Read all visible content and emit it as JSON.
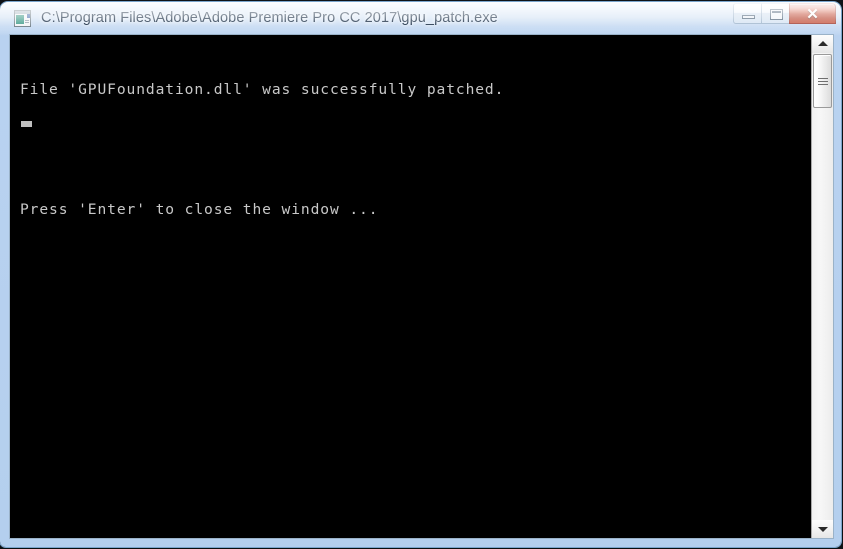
{
  "window": {
    "title": "C:\\Program Files\\Adobe\\Adobe Premiere Pro CC 2017\\gpu_patch.exe",
    "icon": "console-window-icon",
    "controls": {
      "minimize_label": "",
      "maximize_label": "",
      "close_label": "✕"
    },
    "accent_colors": {
      "frame": "#b4cfee",
      "titlebar_text": "#0b2038",
      "close_button": "#c2462f",
      "console_background": "#000000",
      "console_text": "#c8c8c8"
    }
  },
  "console": {
    "lines": [
      "File 'GPUFoundation.dll' was successfully patched.",
      "",
      "Press 'Enter' to close the window ..."
    ],
    "cursor": "block"
  },
  "scrollbar": {
    "up_arrow": "scroll-up-arrow",
    "down_arrow": "scroll-down-arrow",
    "thumb": "scroll-thumb"
  }
}
